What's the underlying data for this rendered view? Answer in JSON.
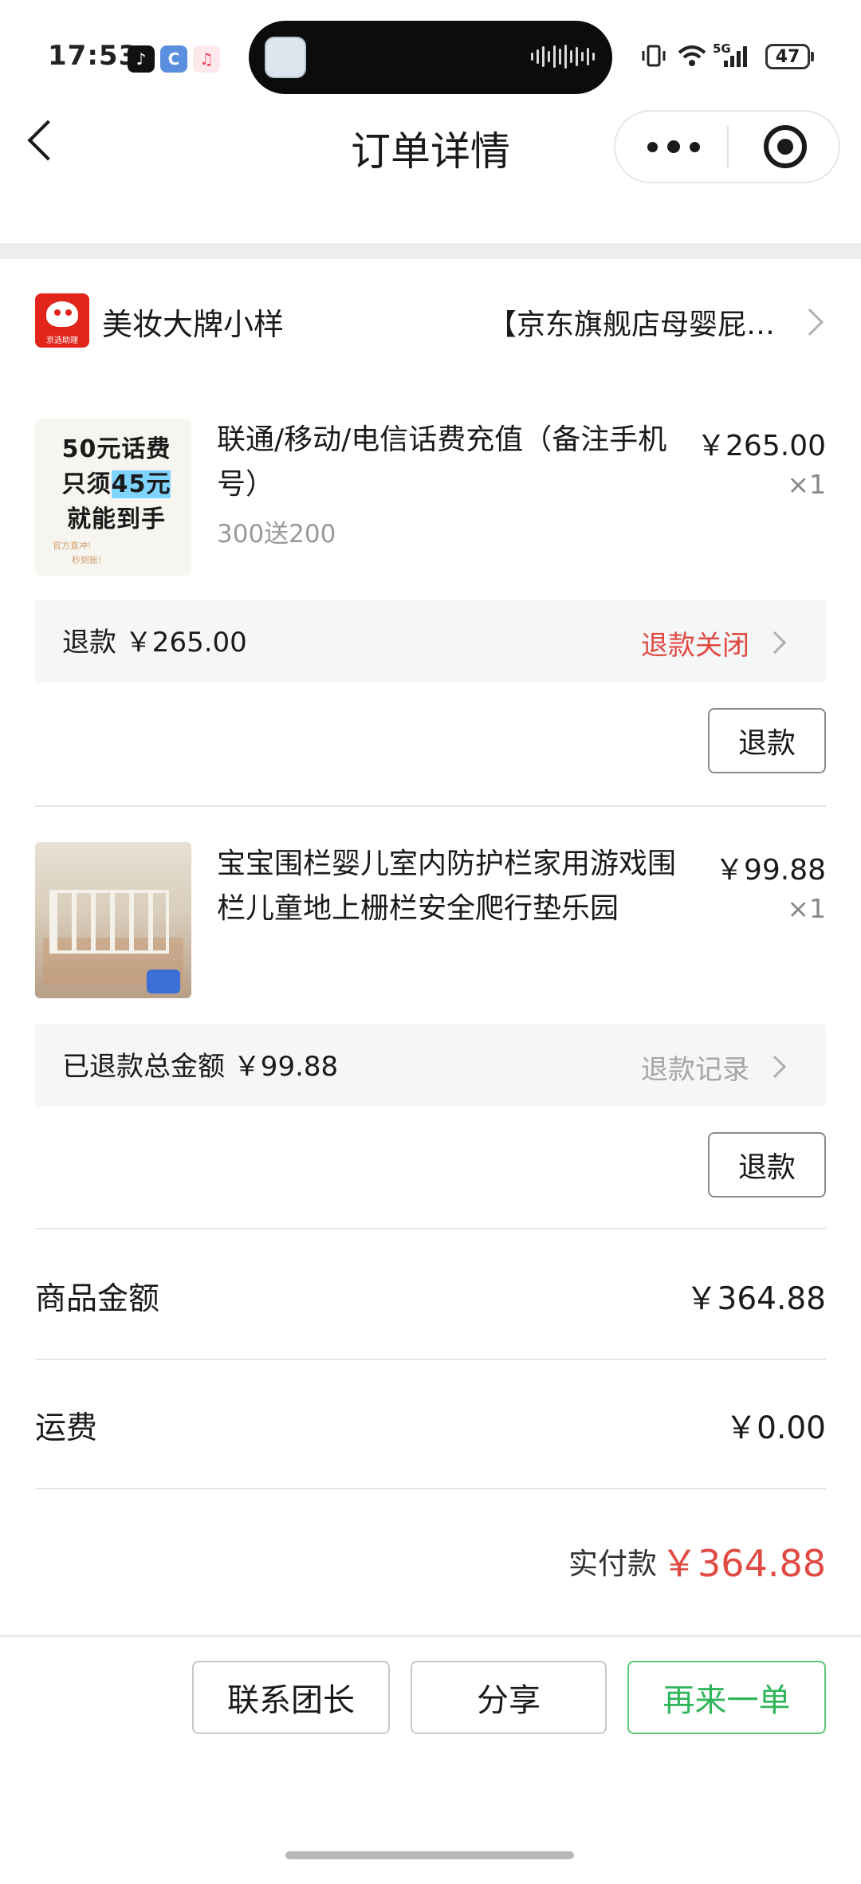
{
  "status_bar": {
    "time": "17:53",
    "battery": "47",
    "network": "5G"
  },
  "nav": {
    "title": "订单详情"
  },
  "shop": {
    "name": "美妆大牌小样",
    "logo_caption": "京选助理",
    "store": "【京东旗舰店母婴屁…"
  },
  "items": [
    {
      "title": "联通/移动/电信话费充值（备注手机号）",
      "spec": "300送200",
      "price": "￥265.00",
      "qty": "×1",
      "thumb_lines": [
        "50元话费",
        "只须",
        "45元",
        "就能到手"
      ],
      "thumb_small": [
        "官方直冲!",
        "秒到账!"
      ],
      "refund_label": "退款 ￥265.00",
      "refund_status": "退款关闭",
      "refund_status_color": "#e04a43",
      "refund_button": "退款"
    },
    {
      "title": "宝宝围栏婴儿室内防护栏家用游戏围栏儿童地上栅栏安全爬行垫乐园",
      "spec": "",
      "price": "￥99.88",
      "qty": "×1",
      "refund_label": "已退款总金额 ￥99.88",
      "refund_status": "退款记录",
      "refund_status_color": "#a6a6a6",
      "refund_button": "退款"
    }
  ],
  "summary": {
    "goods_label": "商品金额",
    "goods_value": "￥364.88",
    "shipping_label": "运费",
    "shipping_value": "￥0.00",
    "paid_label": "实付款",
    "paid_value": "￥364.88"
  },
  "actions": {
    "contact": "联系团长",
    "share": "分享",
    "reorder": "再来一单"
  },
  "colors": {
    "accent_red": "#e04a43",
    "accent_green": "#2fb55a"
  }
}
